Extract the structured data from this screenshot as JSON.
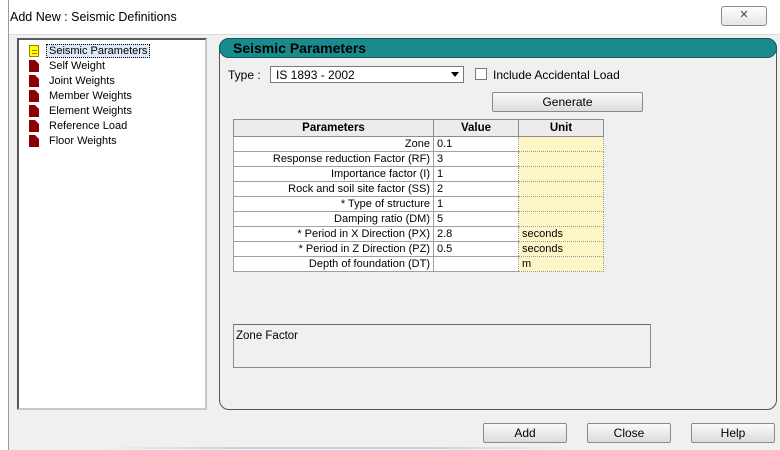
{
  "window": {
    "title": "Add New : Seismic Definitions",
    "close_glyph": "✕"
  },
  "tree": {
    "items": [
      {
        "label": "Seismic Parameters",
        "selected": true
      },
      {
        "label": "Self Weight"
      },
      {
        "label": "Joint Weights"
      },
      {
        "label": "Member Weights"
      },
      {
        "label": "Element Weights"
      },
      {
        "label": "Reference Load"
      },
      {
        "label": "Floor Weights"
      }
    ]
  },
  "panel": {
    "title": "Seismic Parameters",
    "type_label": "Type :",
    "type_value": "IS 1893 - 2002",
    "accidental_label": "Include Accidental Load",
    "accidental_checked": false,
    "generate_label": "Generate"
  },
  "table": {
    "headers": [
      "Parameters",
      "Value",
      "Unit"
    ],
    "rows": [
      {
        "param": "Zone",
        "value": "0.1",
        "unit": ""
      },
      {
        "param": "Response reduction Factor (RF)",
        "value": "3",
        "unit": ""
      },
      {
        "param": "Importance factor (I)",
        "value": "1",
        "unit": ""
      },
      {
        "param": "Rock and soil site factor (SS)",
        "value": "2",
        "unit": ""
      },
      {
        "param": "* Type of structure",
        "value": "1",
        "unit": ""
      },
      {
        "param": "Damping ratio (DM)",
        "value": "5",
        "unit": ""
      },
      {
        "param": "* Period in X Direction (PX)",
        "value": "2.8",
        "unit": "seconds"
      },
      {
        "param": "* Period in Z Direction (PZ)",
        "value": "0.5",
        "unit": "seconds"
      },
      {
        "param": "Depth of foundation (DT)",
        "value": "",
        "unit": "m"
      }
    ]
  },
  "description": {
    "text": "Zone Factor"
  },
  "buttons": {
    "add": "Add",
    "close": "Close",
    "help": "Help"
  },
  "colors": {
    "header_accent": "#1a8b8c",
    "unit_cell": "#fff6c8",
    "tree_icon": "#8b0000",
    "selected_icon": "#ffff00"
  }
}
